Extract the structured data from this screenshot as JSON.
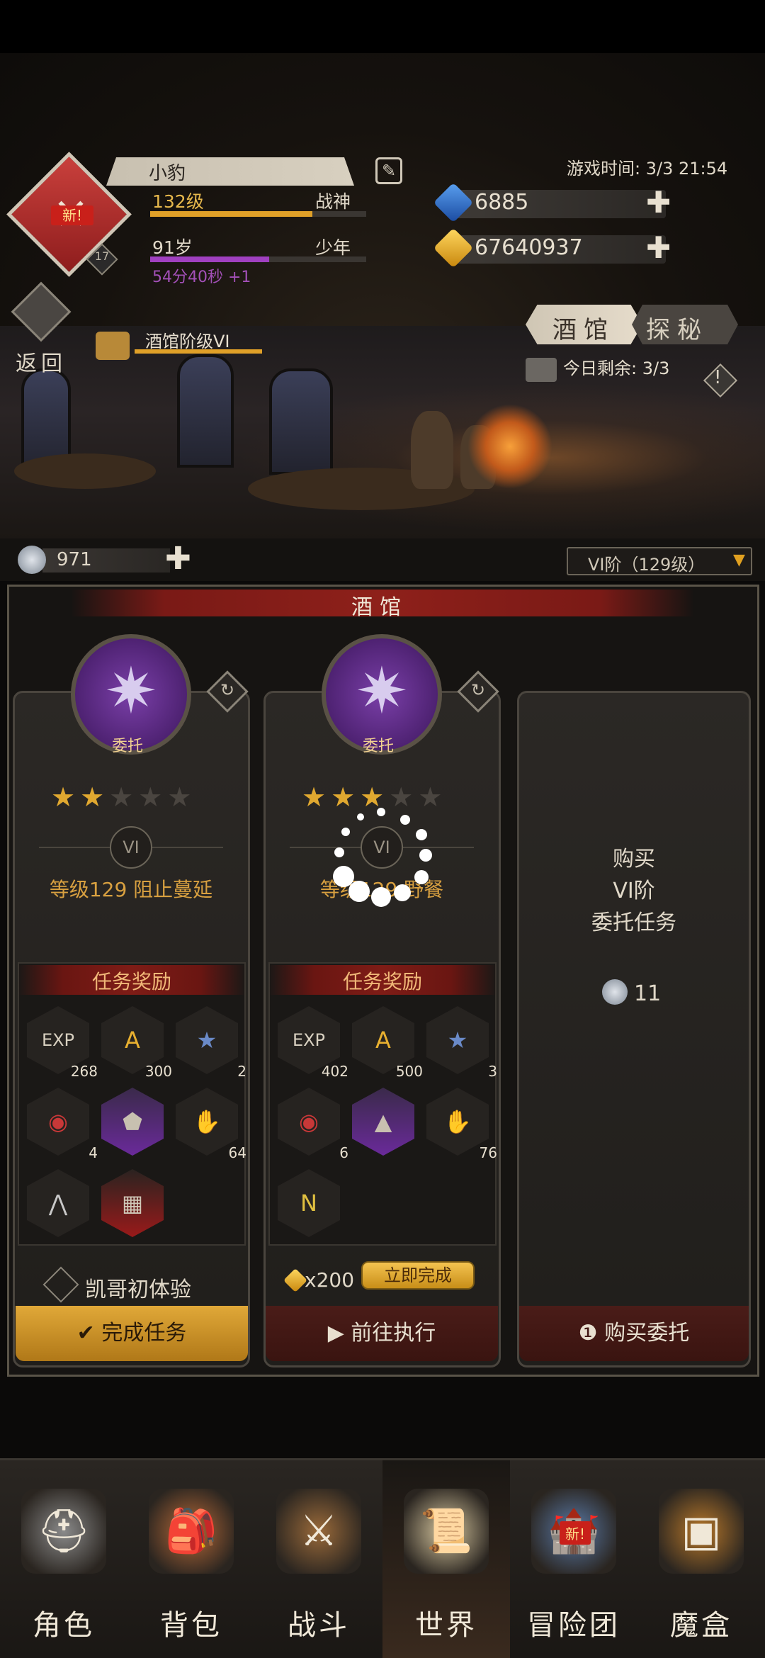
{
  "player": {
    "name": "小豹",
    "level": "132级",
    "title": "战神",
    "age": "91岁",
    "stage": "少年",
    "timer": "54分40秒 +1",
    "avatar_badge": "新!",
    "avatar_level": "17",
    "level_progress": 0.75,
    "age_progress": 0.55
  },
  "game_time": "游戏时间: 3/3 21:54",
  "resources": {
    "gems": "6885",
    "gold": "67640937"
  },
  "back_label": "返回",
  "tavern_rank": "酒馆阶级VI",
  "tabs": {
    "tavern": "酒馆",
    "explore": "探秘"
  },
  "remaining": "今日剩余: 3/3",
  "silver": "971",
  "tier_select": "VI阶（129级）",
  "panel_title": "酒馆",
  "cards": [
    {
      "emblem_label": "委托",
      "stars": 2,
      "tier": "VI",
      "quest_name": "等级129 阻止蔓延",
      "reward_title": "任务奖励",
      "rewards": [
        {
          "icon": "exp-icon",
          "glyph": "EXP",
          "count": "268"
        },
        {
          "icon": "gold-coin-icon",
          "glyph": "A",
          "count": "300"
        },
        {
          "icon": "star-medal-icon",
          "glyph": "★",
          "count": "2"
        },
        {
          "icon": "red-medal-icon",
          "glyph": "◉",
          "count": "4"
        },
        {
          "icon": "shield-icon",
          "glyph": "⬟",
          "count": ""
        },
        {
          "icon": "glove-icon",
          "glyph": "✋",
          "count": "64"
        },
        {
          "icon": "rank-up-icon",
          "glyph": "⋀",
          "count": ""
        },
        {
          "icon": "rune-stone-icon",
          "glyph": "▦",
          "count": ""
        }
      ],
      "bonus": "凯哥初体验",
      "action": "完成任务"
    },
    {
      "emblem_label": "委托",
      "stars": 3,
      "tier": "VI",
      "quest_name": "等级129 野餐",
      "reward_title": "任务奖励",
      "rewards": [
        {
          "icon": "exp-icon",
          "glyph": "EXP",
          "count": "402"
        },
        {
          "icon": "gold-coin-icon",
          "glyph": "A",
          "count": "500"
        },
        {
          "icon": "star-medal-icon",
          "glyph": "★",
          "count": "3"
        },
        {
          "icon": "red-medal-icon",
          "glyph": "◉",
          "count": "6"
        },
        {
          "icon": "wizard-hat-icon",
          "glyph": "▲",
          "count": ""
        },
        {
          "icon": "glove-icon",
          "glyph": "✋",
          "count": "76"
        },
        {
          "icon": "rank-icon",
          "glyph": "N",
          "count": ""
        }
      ],
      "cost": "x200",
      "instant": "立即完成",
      "action": "前往执行"
    }
  ],
  "buy_card": {
    "line1": "购买",
    "line2": "VI阶",
    "line3": "委托任务",
    "price": "11",
    "action": "购买委托"
  },
  "nav": [
    {
      "label": "角色",
      "icon": "helmet-icon"
    },
    {
      "label": "背包",
      "icon": "backpack-icon"
    },
    {
      "label": "战斗",
      "icon": "sword-shield-icon"
    },
    {
      "label": "世界",
      "icon": "scroll-icon"
    },
    {
      "label": "冒险团",
      "icon": "castle-icon",
      "badge": "新!"
    },
    {
      "label": "魔盒",
      "icon": "magic-box-icon"
    }
  ]
}
